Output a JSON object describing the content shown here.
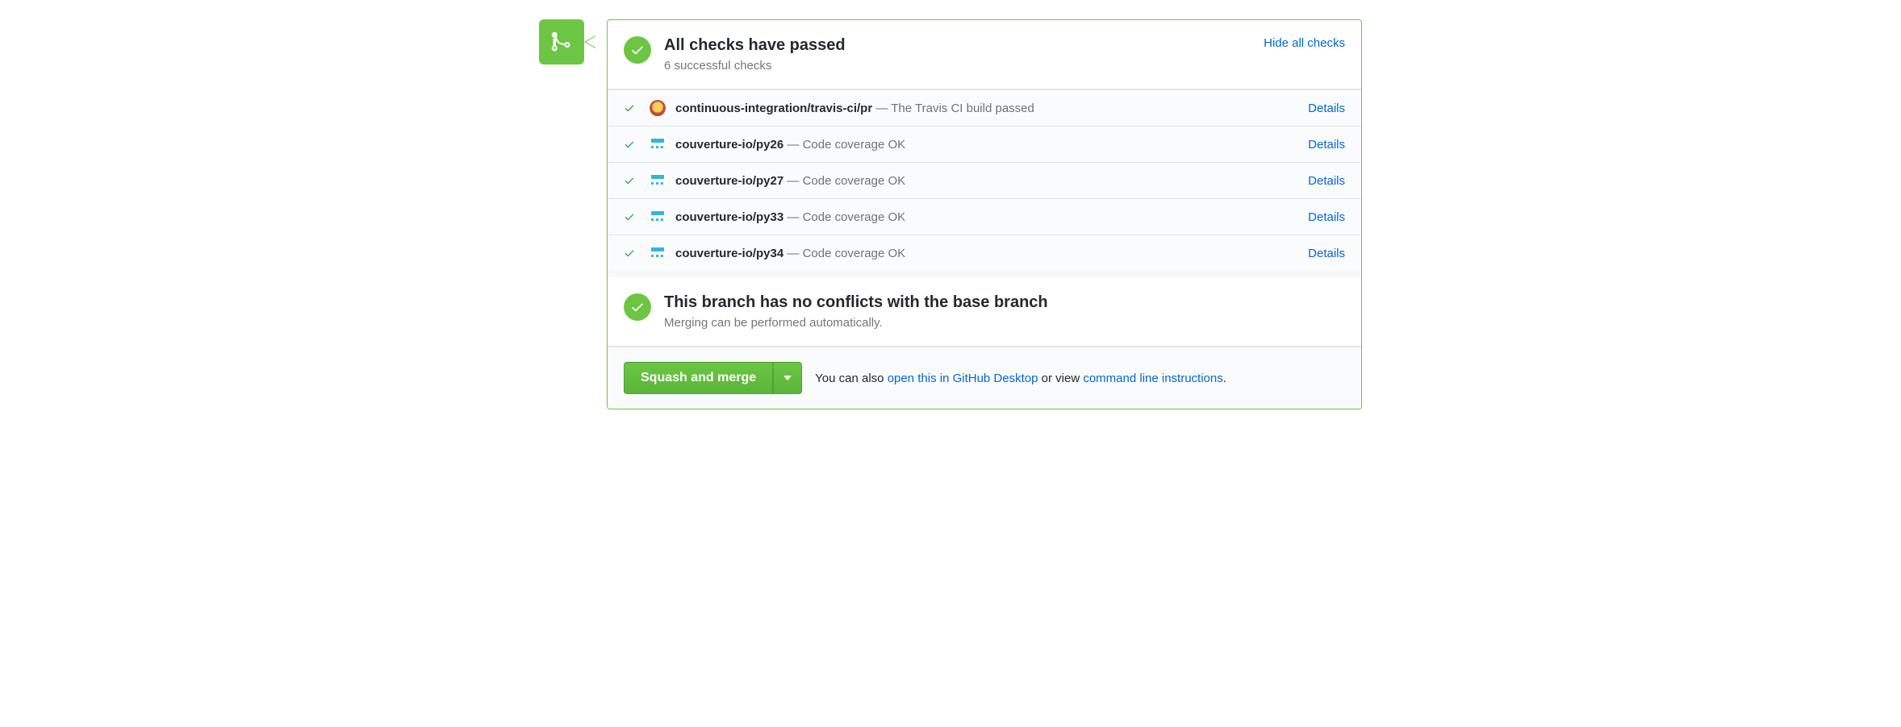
{
  "header": {
    "title": "All checks have passed",
    "subtitle": "6 successful checks",
    "toggle": "Hide all checks"
  },
  "checks": [
    {
      "name": "continuous-integration/travis-ci/pr",
      "desc": "The Travis CI build passed",
      "details": "Details",
      "avatar": "travis"
    },
    {
      "name": "couverture-io/py26",
      "desc": "Code coverage OK",
      "details": "Details",
      "avatar": "couv"
    },
    {
      "name": "couverture-io/py27",
      "desc": "Code coverage OK",
      "details": "Details",
      "avatar": "couv"
    },
    {
      "name": "couverture-io/py33",
      "desc": "Code coverage OK",
      "details": "Details",
      "avatar": "couv"
    },
    {
      "name": "couverture-io/py34",
      "desc": "Code coverage OK",
      "details": "Details",
      "avatar": "couv"
    }
  ],
  "conflict": {
    "title": "This branch has no conflicts with the base branch",
    "subtitle": "Merging can be performed automatically."
  },
  "merge": {
    "button": "Squash and merge",
    "hint_prefix": "You can also ",
    "hint_link1": "open this in GitHub Desktop",
    "hint_mid": " or view ",
    "hint_link2": "command line instructions",
    "hint_suffix": "."
  }
}
